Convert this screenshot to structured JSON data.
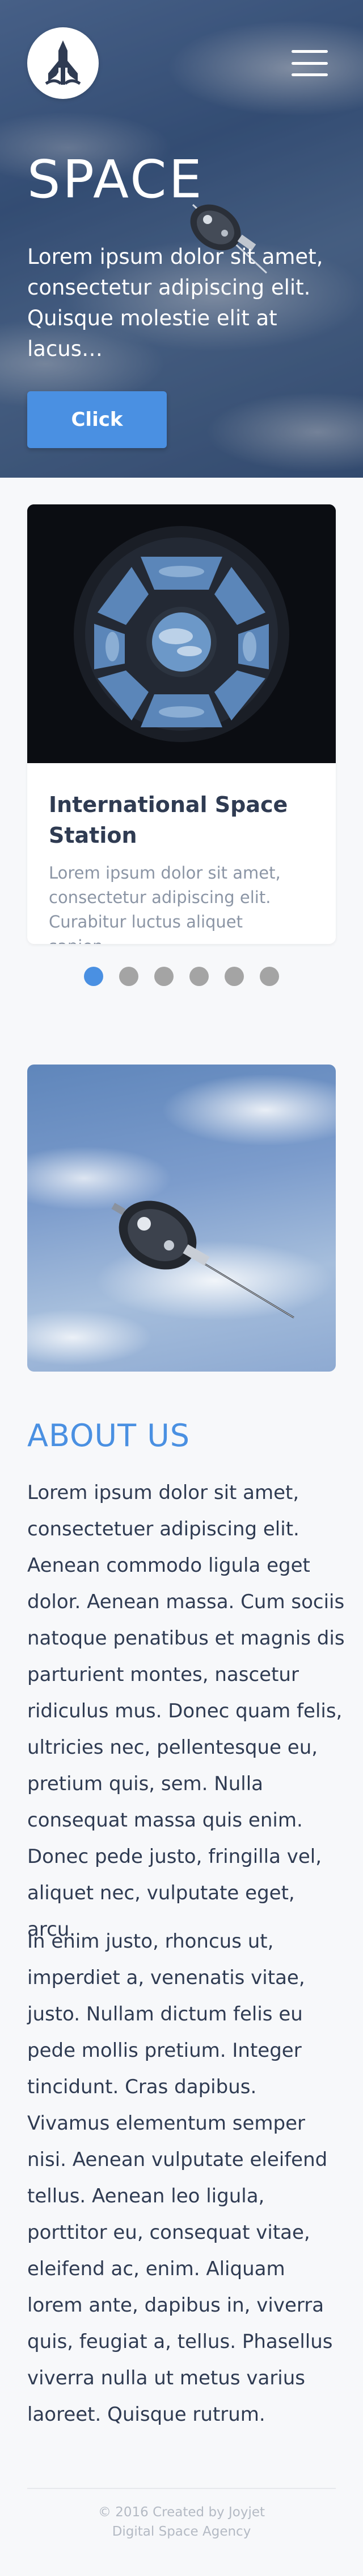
{
  "header": {
    "logo_icon": "rocket-icon",
    "menu_icon": "hamburger-icon"
  },
  "hero": {
    "title": "SPACE",
    "text": "Lorem ipsum dolor sit amet, consectetur adipiscing elit. Quisque molestie elit at lacus…",
    "button_label": "Click"
  },
  "card": {
    "title": "International Space Station",
    "text": "Lorem ipsum dolor sit amet, consectetur adipiscing elit. Curabitur luctus aliquet sapien…"
  },
  "carousel": {
    "dot_count": 6,
    "active_index": 0
  },
  "about": {
    "title": "ABOUT US",
    "paragraph1": "Lorem ipsum dolor sit amet, consectetuer adipiscing elit. Aenean commodo ligula eget dolor. Aenean massa. Cum sociis natoque penatibus et magnis dis parturient montes, nascetur ridiculus mus. Donec quam felis, ultricies nec, pellentesque eu, pretium quis, sem. Nulla consequat massa quis enim. Donec pede justo, fringilla vel, aliquet nec, vulputate eget, arcu.",
    "paragraph2": "In enim justo, rhoncus ut, imperdiet a, venenatis vitae, justo. Nullam dictum felis eu pede mollis pretium. Integer tincidunt. Cras dapibus. Vivamus elementum semper nisi. Aenean vulputate eleifend tellus. Aenean leo ligula, porttitor eu, consequat vitae, eleifend ac, enim. Aliquam lorem ante, dapibus in, viverra quis, feugiat a, tellus. Phasellus viverra nulla ut metus varius laoreet. Quisque rutrum."
  },
  "footer": {
    "line1": "© 2016 Created by Joyjet",
    "line2": "Digital Space Agency"
  },
  "colors": {
    "accent": "#4a90e2",
    "text": "#2f3b52",
    "muted": "#8b95a5",
    "dot_inactive": "#a4a4a4",
    "background": "#f7f8fa"
  }
}
